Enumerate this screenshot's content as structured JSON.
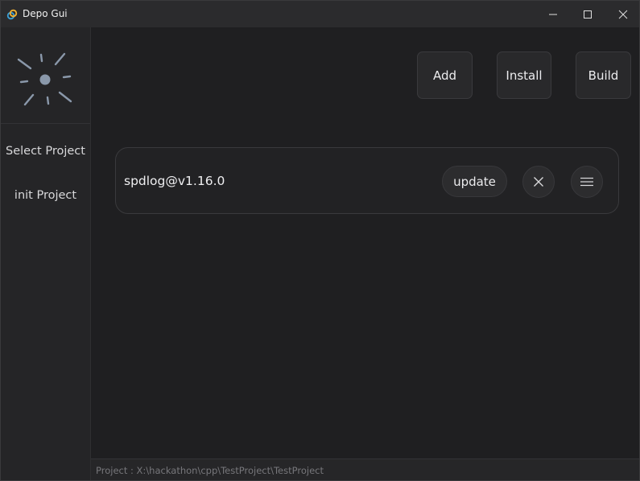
{
  "window": {
    "title": "Depo Gui",
    "icon": "link-icon"
  },
  "sidebar": {
    "logo": "sunburst-logo",
    "items": [
      {
        "label": "Select Project"
      },
      {
        "label": "init Project"
      }
    ]
  },
  "toolbar": {
    "add_label": "Add",
    "install_label": "Install",
    "build_label": "Build"
  },
  "packages": [
    {
      "name": "spdlog@v1.16.0",
      "update_label": "update",
      "remove_icon": "close-icon",
      "menu_icon": "hamburger-menu-icon"
    }
  ],
  "status": {
    "text": "Project : X:\\hackathon\\cpp\\TestProject\\TestProject"
  },
  "colors": {
    "background": "#1f1f21",
    "sidebar": "#252527",
    "titlebar": "#2b2b2d",
    "logo": "#8a98aa",
    "app_icon_primary": "#f2b233",
    "app_icon_secondary": "#3aa0d8"
  }
}
